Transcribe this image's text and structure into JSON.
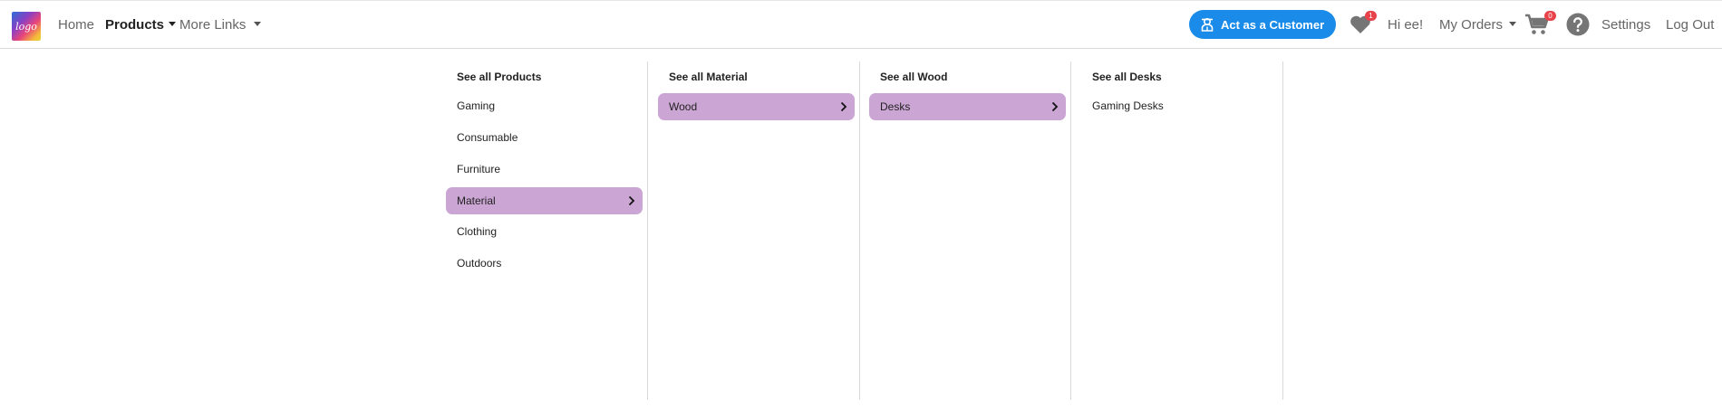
{
  "nav": {
    "logo_text": "logo",
    "home": "Home",
    "products": "Products",
    "more_links": "More Links",
    "act_as_customer": "Act as a Customer",
    "wishlist_count": "1",
    "greeting": "Hi ee!",
    "my_orders": "My Orders",
    "cart_count": "0",
    "settings": "Settings",
    "logout": "Log Out"
  },
  "menu": {
    "columns": [
      {
        "header": "See all Products",
        "items": [
          "Gaming",
          "Consumable",
          "Furniture",
          "Material",
          "Clothing",
          "Outdoors"
        ],
        "selected": "Material"
      },
      {
        "header": "See all Material",
        "items": [
          "Wood"
        ],
        "selected": "Wood"
      },
      {
        "header": "See all Wood",
        "items": [
          "Desks"
        ],
        "selected": "Desks"
      },
      {
        "header": "See all Desks",
        "items": [
          "Gaming Desks"
        ],
        "selected": ""
      }
    ]
  },
  "colors": {
    "accent_button": "#1a8be8",
    "selected_item": "#cba5d3",
    "badge": "#e8434a",
    "icon_gray": "#757575"
  },
  "icons": {
    "wishlist": "heart-icon",
    "cart": "cart-icon",
    "help": "question-circle-icon",
    "act_as_customer": "customer-icon",
    "submenu": "chevron-right-icon"
  }
}
